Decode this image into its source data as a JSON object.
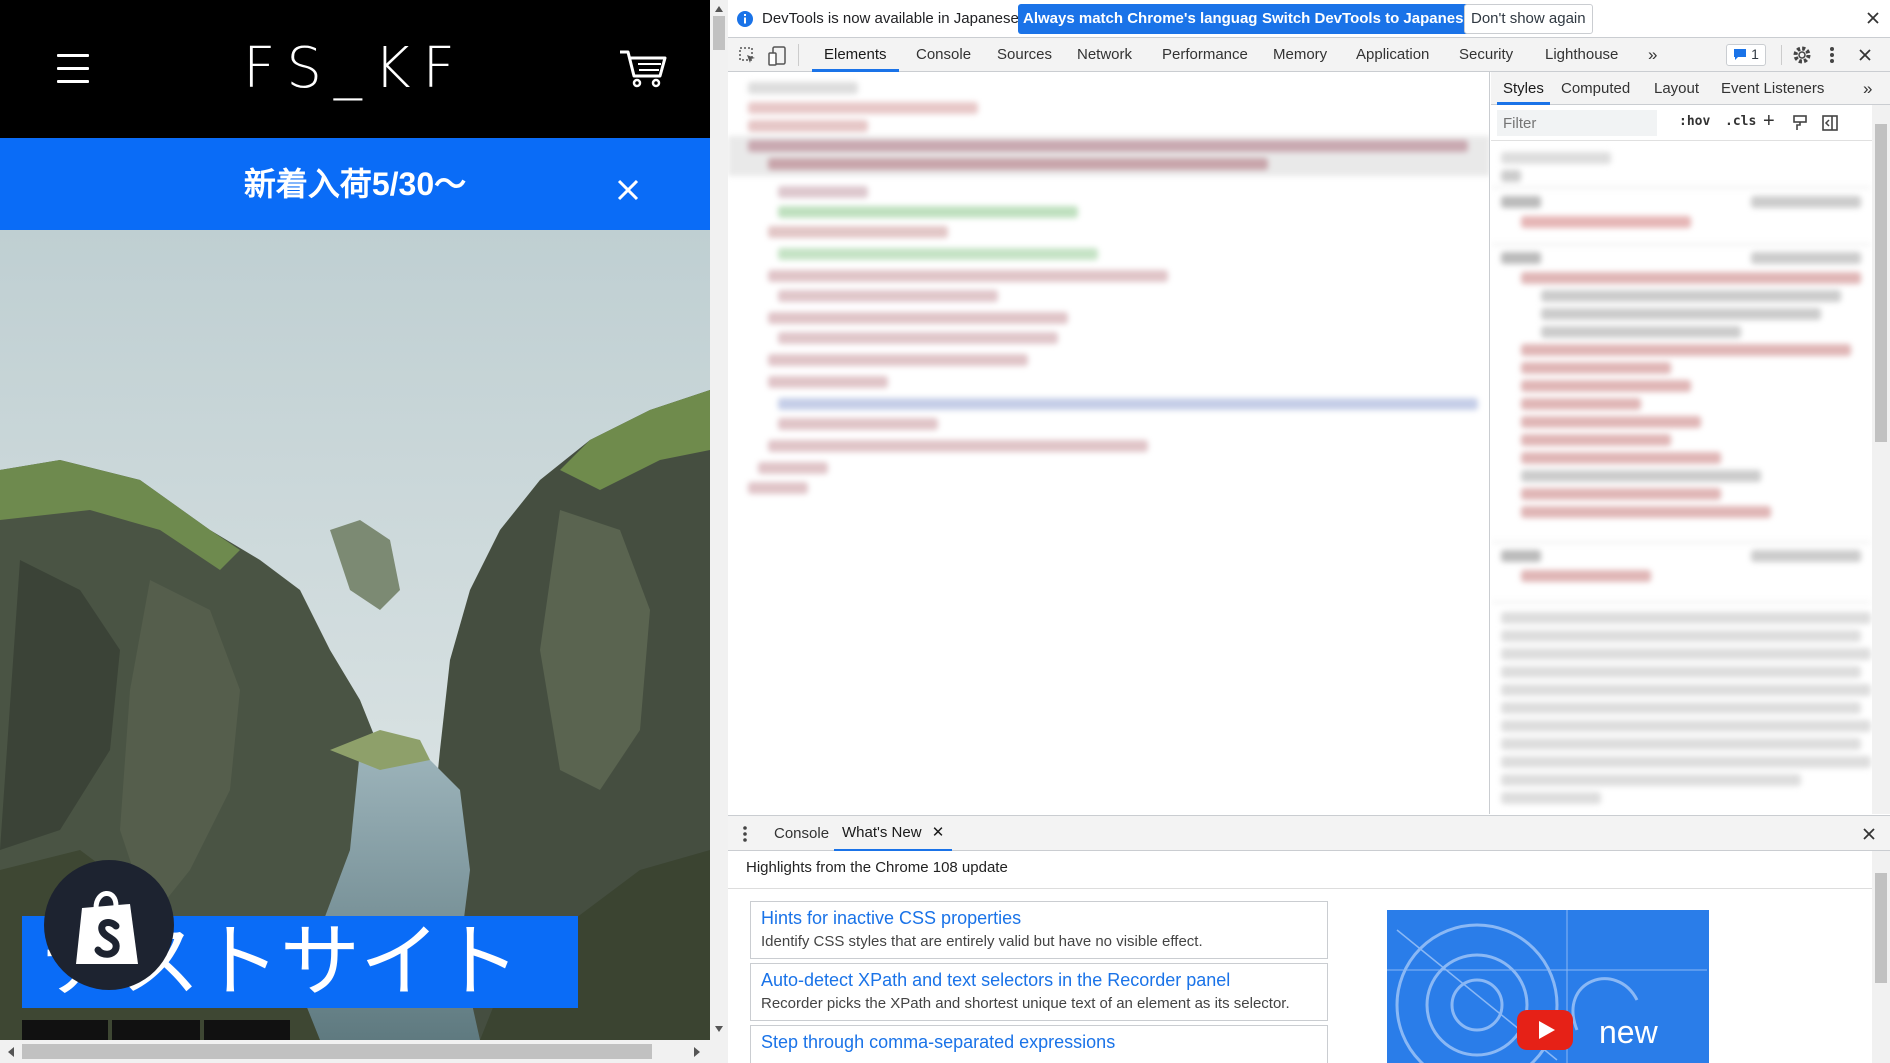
{
  "site": {
    "logo": "FS_KF",
    "announcement": "新着入荷5/30〜",
    "hero_caption": "テストサイト",
    "menu_icon": "hamburger-icon",
    "cart_icon": "cart-icon",
    "close_icon": "close-icon",
    "badge_icon": "shopify-bag-icon"
  },
  "devtools": {
    "infobar": {
      "message": "DevTools is now available in Japanese!",
      "btn_match": "Always match Chrome's language",
      "btn_switch": "Switch DevTools to Japanese",
      "btn_dismiss": "Don't show again"
    },
    "tabs": [
      "Elements",
      "Console",
      "Sources",
      "Network",
      "Performance",
      "Memory",
      "Application",
      "Security",
      "Lighthouse"
    ],
    "active_tab": "Elements",
    "more_tabs": "»",
    "issues_count": "1",
    "styles_tabs": [
      "Styles",
      "Computed",
      "Layout",
      "Event Listeners"
    ],
    "styles_more": "»",
    "filter_placeholder": "Filter",
    "hov": ":hov",
    "cls": ".cls",
    "plus": "+",
    "drawer": {
      "tabs": [
        "Console",
        "What's New"
      ],
      "active": "What's New",
      "highlights": "Highlights from the Chrome 108 update",
      "items": [
        {
          "title": "Hints for inactive CSS properties",
          "desc": "Identify CSS styles that are entirely valid but have no visible effect."
        },
        {
          "title": "Auto-detect XPath and text selectors in the Recorder panel",
          "desc": "Recorder picks the XPath and shortest unique text of an element as its selector."
        },
        {
          "title": "Step through comma-separated expressions",
          "desc": ""
        }
      ],
      "promo_text": "new"
    },
    "colors": {
      "accent": "#1a73e8",
      "site_blue": "#0a6cf7"
    }
  }
}
